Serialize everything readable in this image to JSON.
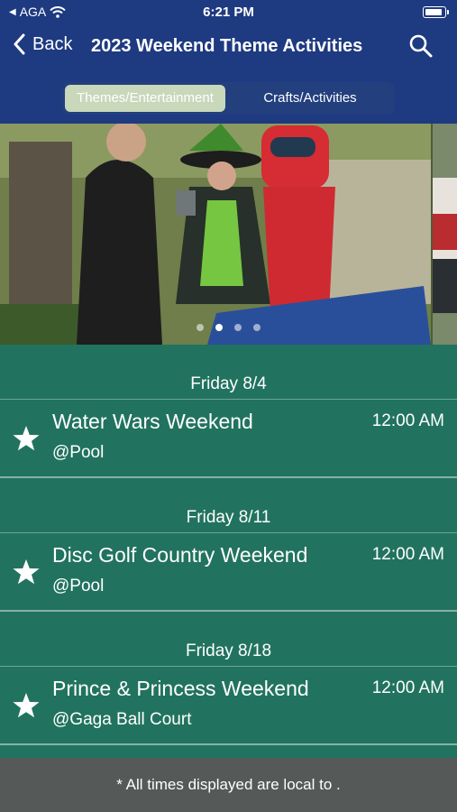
{
  "status_bar": {
    "carrier": "AGA",
    "time": "6:21 PM"
  },
  "nav": {
    "back_label": "Back",
    "title": "2023 Weekend Theme Activities"
  },
  "segments": [
    {
      "label": "Themes/Entertainment",
      "selected": true
    },
    {
      "label": "Crafts/Activities",
      "selected": false
    }
  ],
  "carousel": {
    "page_count": 4,
    "current_page": 2
  },
  "sections": [
    {
      "date": "Friday 8/4",
      "event": {
        "title": "Water Wars Weekend",
        "location": "@Pool",
        "time": "12:00 AM"
      }
    },
    {
      "date": "Friday 8/11",
      "event": {
        "title": "Disc Golf Country Weekend",
        "location": "@Pool",
        "time": "12:00 AM"
      }
    },
    {
      "date": "Friday 8/18",
      "event": {
        "title": "Prince & Princess Weekend",
        "location": "@Gaga Ball Court",
        "time": "12:00 AM"
      }
    }
  ],
  "footer": {
    "note": "* All times displayed are local to ."
  },
  "colors": {
    "header": "#1e3a80",
    "list_bg": "#21735f",
    "footer": "#555a59",
    "segment_active": "#c9d7bb"
  }
}
